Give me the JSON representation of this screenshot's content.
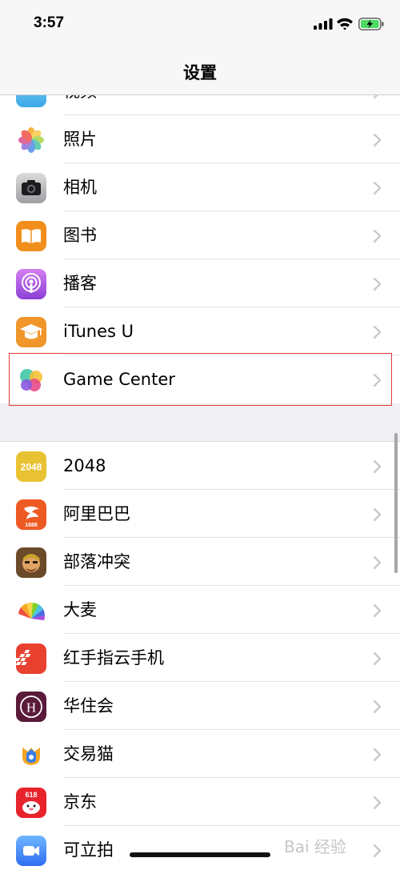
{
  "status_bar": {
    "time": "3:57"
  },
  "nav": {
    "title": "设置"
  },
  "group1": {
    "partial_label": "视频",
    "items": [
      {
        "label": "照片",
        "icon": "photos-icon"
      },
      {
        "label": "相机",
        "icon": "camera-icon"
      },
      {
        "label": "图书",
        "icon": "books-icon"
      },
      {
        "label": "播客",
        "icon": "podcasts-icon"
      },
      {
        "label": "iTunes U",
        "icon": "itunes-u-icon"
      },
      {
        "label": "Game Center",
        "icon": "game-center-icon"
      }
    ]
  },
  "group2": {
    "items": [
      {
        "label": "2048",
        "icon": "app-2048-icon",
        "icon_text": "2048"
      },
      {
        "label": "阿里巴巴",
        "icon": "alibaba-icon",
        "icon_text": "1688"
      },
      {
        "label": "部落冲突",
        "icon": "clash-of-clans-icon"
      },
      {
        "label": "大麦",
        "icon": "damai-icon"
      },
      {
        "label": "红手指云手机",
        "icon": "redfinger-icon"
      },
      {
        "label": "华住会",
        "icon": "huazhu-icon",
        "icon_text": "H"
      },
      {
        "label": "交易猫",
        "icon": "jiaoyimao-icon"
      },
      {
        "label": "京东",
        "icon": "jd-icon",
        "icon_text": "618"
      },
      {
        "label": "可立拍",
        "icon": "clips-icon"
      }
    ]
  },
  "watermark": "Bai 经验",
  "colors": {
    "highlight": "#e23a3a",
    "group_bg": "#ffffff",
    "page_bg": "#efeff4"
  }
}
